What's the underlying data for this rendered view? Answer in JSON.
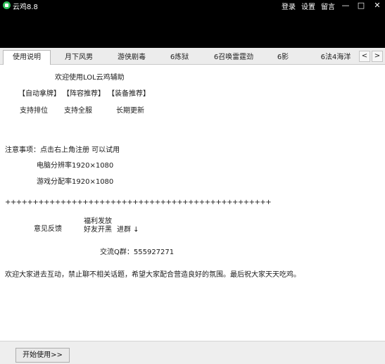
{
  "window": {
    "title": "云鸡8.8",
    "links": {
      "register": "登录",
      "settings": "设置",
      "message": "留言"
    },
    "controls": {
      "minimize": "—",
      "maximize": "□",
      "close": "✕"
    }
  },
  "tabs": [
    {
      "label": "使用说明",
      "active": true
    },
    {
      "label": "月下风男"
    },
    {
      "label": "游侠剧毒"
    },
    {
      "label": "6炼狱"
    },
    {
      "label": "6召唤雷霆劲"
    },
    {
      "label": "6影"
    },
    {
      "label": "6法4海洋"
    }
  ],
  "tab_scroll": {
    "left": "<",
    "right": ">"
  },
  "content": {
    "welcome": "欢迎使用LOL云鸡辅助",
    "features": [
      "【自动拿牌】",
      "【阵容推荐】",
      "【装备推荐】"
    ],
    "supports": [
      "支持排位",
      "支持全服",
      "长期更新"
    ],
    "notice_label": "注意事项：点击右上角注册 可以试用",
    "resolution_computer": "电脑分辨率1920×1080",
    "resolution_game": "游戏分配率1920×1080",
    "divider": "++++++++++++++++++++++++++++++++++++++++++++++++",
    "feedback": "意见反馈",
    "benefits_line1": "福利发放",
    "benefits_line2": "好友开黑",
    "join_group": "进群 ↓",
    "qq_group": "交流Q群：555927271",
    "footer_text": "欢迎大家进去互动，禁止聊不相关话题，希望大家配合营造良好的氛围。最后祝大家天天吃鸡。"
  },
  "bottom": {
    "start_button": "开始使用>>"
  }
}
